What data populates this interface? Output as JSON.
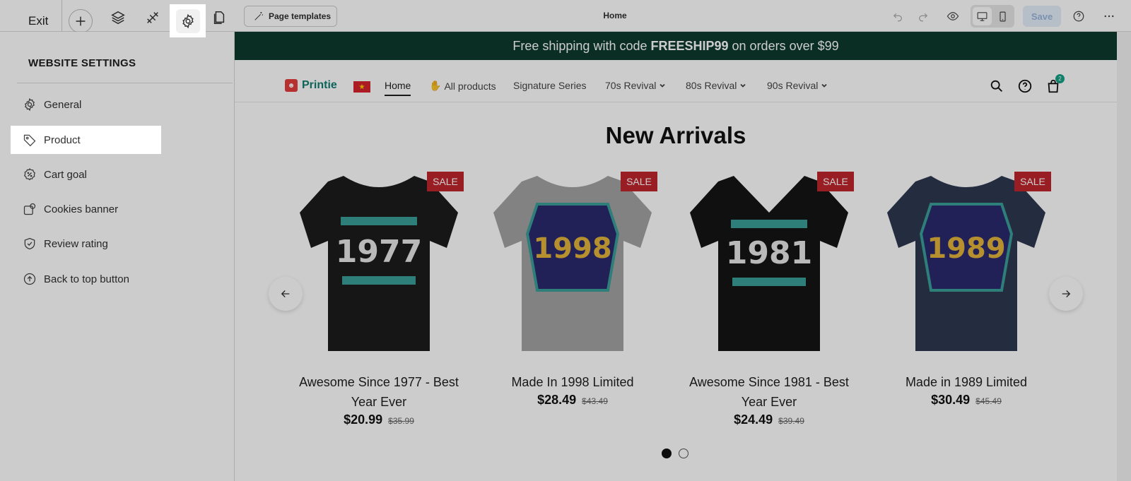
{
  "toolbar": {
    "exit_label": "Exit",
    "page_templates_label": "Page templates",
    "page_title": "Home",
    "save_label": "Save"
  },
  "sidebar": {
    "title": "WEBSITE SETTINGS",
    "items": [
      {
        "label": "General",
        "icon": "gear-icon"
      },
      {
        "label": "Product",
        "icon": "tag-icon"
      },
      {
        "label": "Cart goal",
        "icon": "percent-badge-icon"
      },
      {
        "label": "Cookies banner",
        "icon": "cookie-icon"
      },
      {
        "label": "Review rating",
        "icon": "shield-check-icon"
      },
      {
        "label": "Back to top button",
        "icon": "arrow-up-circle-icon"
      }
    ],
    "active_item": "Product"
  },
  "promo": {
    "text_before": "Free shipping with code",
    "code": "FREESHIP99",
    "text_after": "on orders over $99",
    "background": "#0d3a2d"
  },
  "nav": {
    "brand": "Printie",
    "links": [
      {
        "label": "Home"
      },
      {
        "label": "All products"
      },
      {
        "label": "Signature Series"
      },
      {
        "label": "70s Revival"
      },
      {
        "label": "80s Revival"
      },
      {
        "label": "90s Revival"
      }
    ],
    "cart_count": "2"
  },
  "section": {
    "title": "New Arrivals"
  },
  "products": [
    {
      "name": "Awesome Since 1977 - Best Year Ever",
      "price": "$20.99",
      "compare_price": "$35.99",
      "badge": "SALE",
      "shirt_color": "#1c1c1c",
      "year": "1977"
    },
    {
      "name": "Made In 1998 Limited",
      "price": "$28.49",
      "compare_price": "$43.49",
      "badge": "SALE",
      "shirt_color": "#a3a3a3",
      "year": "1998"
    },
    {
      "name": "Awesome Since 1981 - Best Year Ever",
      "price": "$24.49",
      "compare_price": "$39.49",
      "badge": "SALE",
      "shirt_color": "#141414",
      "year": "1981"
    },
    {
      "name": "Made in 1989 Limited",
      "price": "$30.49",
      "compare_price": "$45.49",
      "badge": "SALE",
      "shirt_color": "#2e3851",
      "year": "1989"
    }
  ],
  "carousel": {
    "pages": 2,
    "current_page": 1
  }
}
